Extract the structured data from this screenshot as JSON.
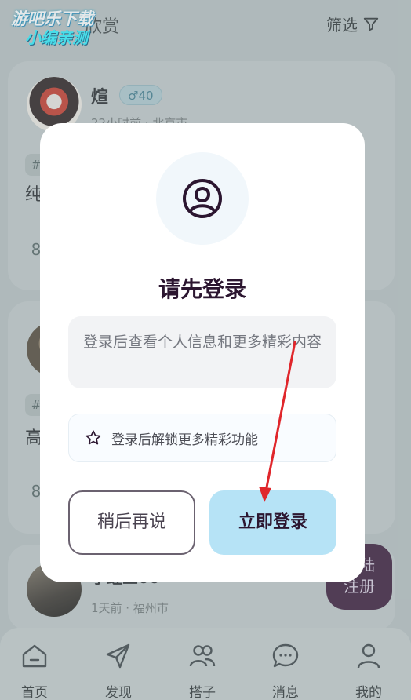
{
  "watermark": {
    "line1": "游吧乐下载",
    "line2": "小编亲测"
  },
  "header": {
    "tab_label": "欣赏",
    "filter_label": "筛选",
    "filter_icon": "funnel-icon"
  },
  "posts": [
    {
      "username": "煊",
      "badge": "♂40",
      "meta": "22小时前 · 北京市",
      "tag_icon": "hashtag-icon",
      "text": "纯"
    },
    {
      "username": "",
      "badge": "",
      "meta": "",
      "tag_icon": "hashtag-icon",
      "text": "高"
    },
    {
      "username": "小蛙三00",
      "badge": "",
      "meta": "1天前 · 福州市"
    }
  ],
  "fab": {
    "line1": "登陆",
    "line2": "注册"
  },
  "tabbar": {
    "items": [
      {
        "label": "首页",
        "icon": "home-icon"
      },
      {
        "label": "发现",
        "icon": "paper-plane-icon"
      },
      {
        "label": "搭子",
        "icon": "people-icon"
      },
      {
        "label": "消息",
        "icon": "chat-bubble-icon"
      },
      {
        "label": "我的",
        "icon": "person-icon"
      }
    ]
  },
  "dialog": {
    "icon": "user-circle-icon",
    "title": "请先登录",
    "message": "登录后查看个人信息和更多精彩内容",
    "feature": "登录后解锁更多精彩功能",
    "feature_icon": "star-outline-icon",
    "later_button": "稍后再说",
    "login_button": "立即登录"
  },
  "colors": {
    "accent": "#b6e3f6",
    "title": "#2c1630",
    "annotation_arrow": "#e0262b",
    "fab": "#3a1b3a"
  }
}
